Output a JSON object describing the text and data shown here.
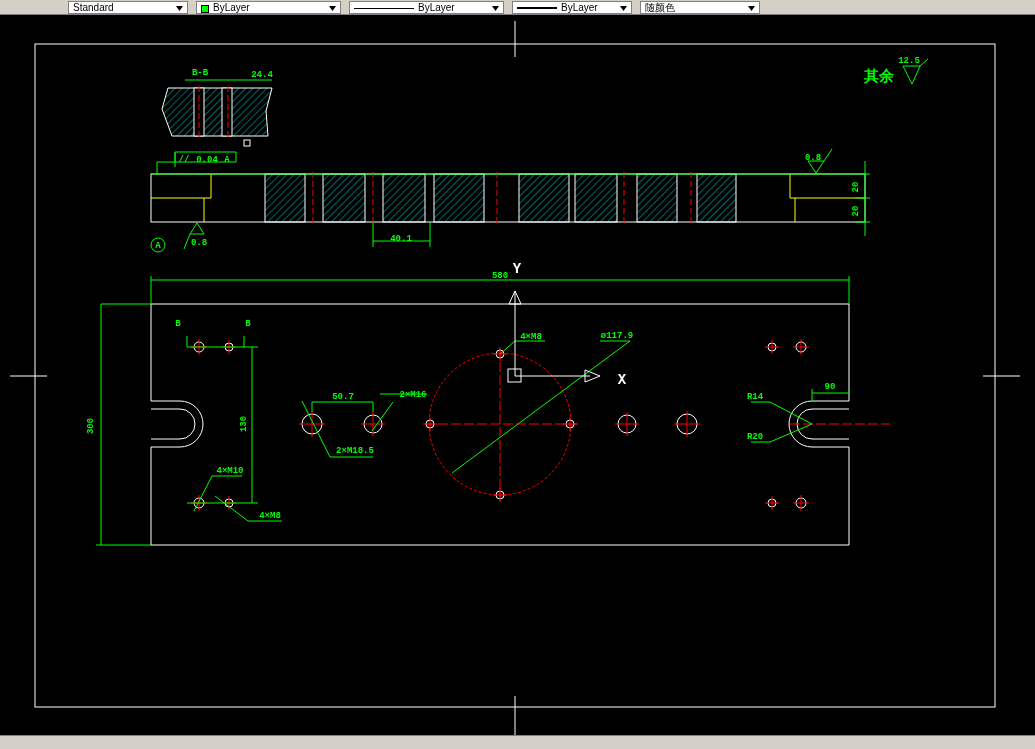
{
  "toolbar": {
    "text_style": "Standard",
    "color": {
      "label": "ByLayer",
      "color": "#00ff00"
    },
    "linetype": "ByLayer",
    "lineweight": "ByLayer",
    "plot_style": "随颜色"
  },
  "drawing": {
    "labels": [
      {
        "text": "B-B",
        "kind": "dimension"
      },
      {
        "text": "24.4",
        "kind": "dimension"
      },
      {
        "text": "//",
        "kind": "dimension"
      },
      {
        "text": "0.04",
        "kind": "dimension"
      },
      {
        "text": "A",
        "kind": "dimension"
      },
      {
        "text": "A",
        "kind": "dimension"
      },
      {
        "text": "0.8",
        "kind": "dimension"
      },
      {
        "text": "40.1",
        "kind": "dimension"
      },
      {
        "text": "0.8",
        "kind": "dimension"
      },
      {
        "text": "20",
        "kind": "dimension"
      },
      {
        "text": "20",
        "kind": "dimension"
      },
      {
        "text": "其余",
        "kind": "note"
      },
      {
        "text": "12.5",
        "kind": "dimension"
      },
      {
        "text": "580",
        "kind": "dimension"
      },
      {
        "text": "Y",
        "kind": "axis"
      },
      {
        "text": "B",
        "kind": "dimension"
      },
      {
        "text": "B",
        "kind": "dimension"
      },
      {
        "text": "300",
        "kind": "dimension"
      },
      {
        "text": "130",
        "kind": "dimension"
      },
      {
        "text": "50.7",
        "kind": "dimension"
      },
      {
        "text": "2×M16",
        "kind": "dimension"
      },
      {
        "text": "2×M18.5",
        "kind": "dimension"
      },
      {
        "text": "4×M8",
        "kind": "dimension"
      },
      {
        "text": "ø117.9",
        "kind": "dimension"
      },
      {
        "text": "X",
        "kind": "axis"
      },
      {
        "text": "R14",
        "kind": "dimension"
      },
      {
        "text": "R20",
        "kind": "dimension"
      },
      {
        "text": "90",
        "kind": "dimension"
      },
      {
        "text": "4×M10",
        "kind": "dimension"
      },
      {
        "text": "4×M8",
        "kind": "dimension"
      }
    ]
  }
}
